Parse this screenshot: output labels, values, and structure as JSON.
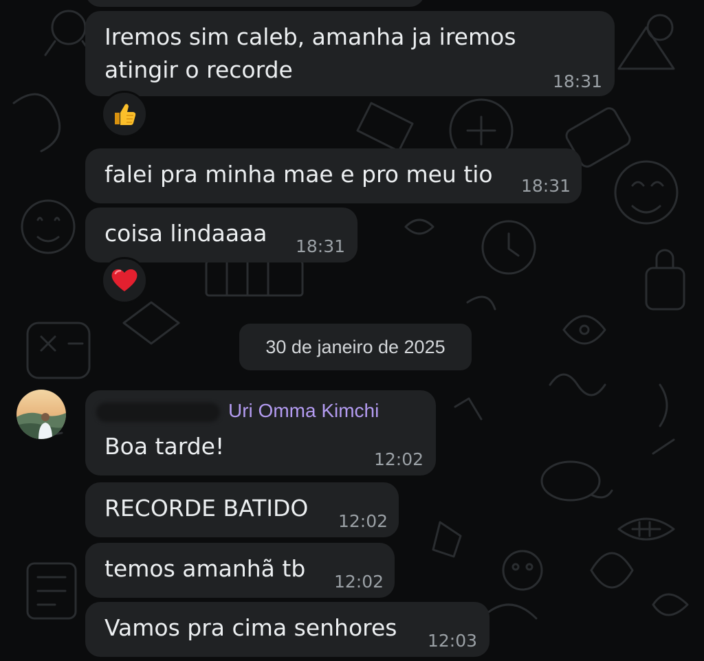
{
  "chat": {
    "messages": [
      {
        "text_line1": "Iremos sim caleb, amanha ja iremos",
        "text_line2": "atingir o recorde",
        "time": "18:31",
        "reaction": "👍"
      },
      {
        "text": "falei pra minha mae e pro meu tio",
        "time": "18:31"
      },
      {
        "text": "coisa lindaaaa",
        "time": "18:31",
        "reaction": "❤️"
      }
    ],
    "date_separator": "30 de janeiro de 2025",
    "incoming": {
      "sender_name": "Uri Omma Kimchi",
      "messages": [
        {
          "text": "Boa tarde!",
          "time": "12:02"
        },
        {
          "text": "RECORDE BATIDO",
          "time": "12:02"
        },
        {
          "text": "temos amanhã tb",
          "time": "12:02"
        },
        {
          "text": "Vamos pra cima senhores",
          "time": "12:03"
        }
      ]
    }
  },
  "colors": {
    "background": "#0b0c0d",
    "bubble": "#202224",
    "sender_name": "#b49cf2",
    "timestamp": "#9ba1a6"
  },
  "icons": {
    "reaction_1": "thumbs-up-emoji",
    "reaction_2": "red-heart-emoji",
    "avatar": "profile-photo"
  }
}
